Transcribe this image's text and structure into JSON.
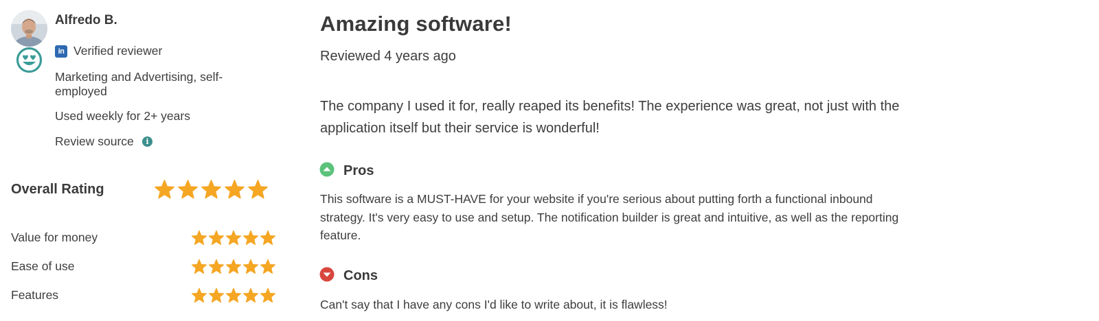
{
  "reviewer": {
    "name": "Alfredo B.",
    "avatar_icon": "user-photo",
    "sentiment_icon": "love-face-icon",
    "verified_icon": "linkedin-icon",
    "verified_label": "Verified reviewer",
    "industry": "Marketing and Advertising, self-employed",
    "usage": "Used weekly for 2+ years",
    "source_label": "Review source",
    "source_icon": "info-icon"
  },
  "ratings": {
    "overall_label": "Overall Rating",
    "overall_stars": 5,
    "star_color": "#f5a623",
    "items": [
      {
        "label": "Value for money",
        "stars": 5
      },
      {
        "label": "Ease of use",
        "stars": 5
      },
      {
        "label": "Features",
        "stars": 5
      }
    ]
  },
  "review": {
    "title": "Amazing software!",
    "reviewed": "Reviewed 4 years ago",
    "body": "The company I used it for, really reaped its benefits! The experience was great, not just with the application itself but their service is wonderful!",
    "pros_label": "Pros",
    "pros_color": "#5cc27b",
    "pros_text": "This software is a MUST-HAVE for your website if you're serious about putting forth a functional inbound strategy. It's very easy to use and setup. The notification builder is great and intuitive, as well as the reporting feature.",
    "cons_label": "Cons",
    "cons_color": "#d9463d",
    "cons_text": "Can't say that I have any cons I'd like to write about, it is flawless!"
  },
  "colors": {
    "accent_teal": "#3b9c98",
    "linkedin_blue": "#2e68b0"
  }
}
